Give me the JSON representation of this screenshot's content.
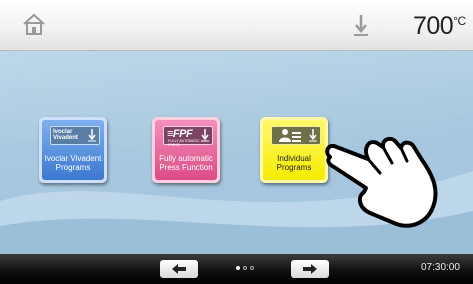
{
  "topbar": {
    "home_icon": "home-icon",
    "temperature_value": "700",
    "temperature_unit": "°C"
  },
  "programs": [
    {
      "label": "Ivoclar Vivadent Programs",
      "logo_text": "Ivoclar\nVivadent",
      "icon": "ivoclar-logo-icon",
      "color": "#3d78d0"
    },
    {
      "label": "Fully automatic Press Function",
      "logo_text": "FPF",
      "logo_sub": "FULLY AUTOMATIC PRESS",
      "icon": "fpf-logo-icon",
      "color": "#dd4c85"
    },
    {
      "label": "Individual Programs",
      "icon": "users-icon",
      "color": "#f6ec00"
    }
  ],
  "footer": {
    "prev_icon": "arrow-left-icon",
    "next_icon": "arrow-right-icon",
    "page_indicator": {
      "current": 1,
      "total": 3
    },
    "clock": "07:30:00"
  },
  "overlay": {
    "icon": "pointing-hand-icon"
  }
}
